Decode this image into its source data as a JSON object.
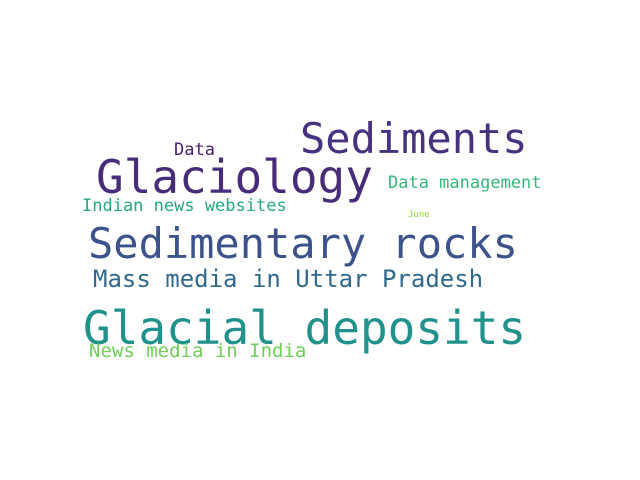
{
  "words": [
    {
      "text": "Sediments",
      "color": "#46327e"
    },
    {
      "text": "Glaciology",
      "color": "#472c7a"
    },
    {
      "text": "Data",
      "color": "#482173"
    },
    {
      "text": "Data management",
      "color": "#35b779"
    },
    {
      "text": "Indian news websites",
      "color": "#22a884"
    },
    {
      "text": "June",
      "color": "#90d743"
    },
    {
      "text": "Sedimentary rocks",
      "color": "#3b528b"
    },
    {
      "text": "Mass media in Uttar Pradesh",
      "color": "#31688e"
    },
    {
      "text": "Glacial deposits",
      "color": "#21918c"
    },
    {
      "text": "News media in India",
      "color": "#6ece58"
    }
  ]
}
